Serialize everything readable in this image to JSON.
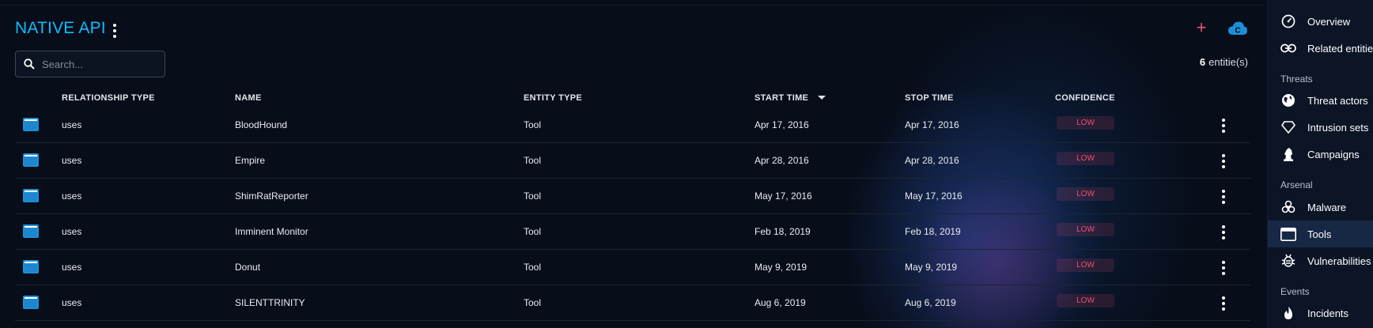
{
  "header": {
    "title": "NATIVE API",
    "add_label": "+",
    "search_placeholder": "Search...",
    "count_number": "6",
    "count_suffix": "entitie(s)"
  },
  "columns": {
    "relationship_type": "RELATIONSHIP TYPE",
    "name": "NAME",
    "entity_type": "ENTITY TYPE",
    "start_time": "START TIME",
    "stop_time": "STOP TIME",
    "confidence": "CONFIDENCE"
  },
  "rows": [
    {
      "relationship": "uses",
      "name": "BloodHound",
      "entity_type": "Tool",
      "start": "Apr 17, 2016",
      "stop": "Apr 17, 2016",
      "confidence": "LOW"
    },
    {
      "relationship": "uses",
      "name": "Empire",
      "entity_type": "Tool",
      "start": "Apr 28, 2016",
      "stop": "Apr 28, 2016",
      "confidence": "LOW"
    },
    {
      "relationship": "uses",
      "name": "ShimRatReporter",
      "entity_type": "Tool",
      "start": "May 17, 2016",
      "stop": "May 17, 2016",
      "confidence": "LOW"
    },
    {
      "relationship": "uses",
      "name": "Imminent Monitor",
      "entity_type": "Tool",
      "start": "Feb 18, 2019",
      "stop": "Feb 18, 2019",
      "confidence": "LOW"
    },
    {
      "relationship": "uses",
      "name": "Donut",
      "entity_type": "Tool",
      "start": "May 9, 2019",
      "stop": "May 9, 2019",
      "confidence": "LOW"
    },
    {
      "relationship": "uses",
      "name": "SILENTTRINITY",
      "entity_type": "Tool",
      "start": "Aug 6, 2019",
      "stop": "Aug 6, 2019",
      "confidence": "LOW"
    }
  ],
  "sidebar": {
    "overview": "Overview",
    "related": "Related entities",
    "section_threats": "Threats",
    "threat_actors": "Threat actors",
    "intrusion_sets": "Intrusion sets",
    "campaigns": "Campaigns",
    "section_arsenal": "Arsenal",
    "malware": "Malware",
    "tools": "Tools",
    "vulnerabilities": "Vulnerabilities",
    "section_events": "Events",
    "incidents": "Incidents"
  },
  "colors": {
    "accent": "#0fbcff",
    "danger": "#f0506e",
    "background": "#070d19",
    "tool_icon": "#1e8fd6"
  }
}
